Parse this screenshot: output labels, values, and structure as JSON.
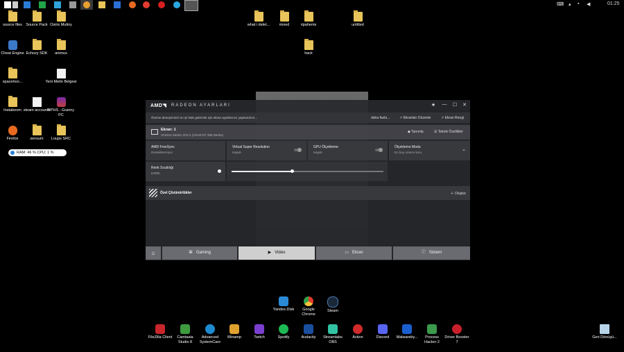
{
  "taskbar": {
    "tray_clock": "01:25"
  },
  "desktop": {
    "icons": [
      {
        "label": "source files"
      },
      {
        "label": "Source Pack"
      },
      {
        "label": "Osiris Mutiny"
      },
      {
        "label": "what i delet..."
      },
      {
        "label": "mixed"
      },
      {
        "label": "ripahems"
      },
      {
        "label": "untitled"
      },
      {
        "label": "Cheat Engine"
      },
      {
        "label": "Echozy SDK"
      },
      {
        "label": "animus"
      },
      {
        "label": "hack"
      },
      {
        "label": "spacehoo..."
      },
      {
        "label": "Yeni Metin Belgesi"
      },
      {
        "label": "Instaboom"
      },
      {
        "label": "steam accounts"
      },
      {
        "label": "RPHS - Granny PC"
      },
      {
        "label": "Firefox"
      },
      {
        "label": "sensum"
      },
      {
        "label": "Loups SRC"
      }
    ]
  },
  "widget": {
    "text": "RAM: 46 %  CPU: 1 %"
  },
  "amd": {
    "logo": "AMD◥",
    "title": "RADEON AYARLARI",
    "info_text": "Özeme deneyiminizi en iyi hale getirmek için ekran ayarlarınızı yapılandırın...",
    "more_link": "daha fazla...",
    "link_screen_layout": "Ekranları Düzenle",
    "link_screen_color": "Ekran Rengi",
    "display": {
      "name": "Ekran: 1",
      "sub": "VA2214 Series, DVI-1 (ASUS R7 265 Series)",
      "btn_identify": "Tanımla",
      "btn_specs": "Teknik Özellikler"
    },
    "settings": [
      {
        "label": "AMD FreeSync",
        "value": "Desteklenmiyor"
      },
      {
        "label": "Virtual Super Resolution",
        "value": "Kapalı"
      },
      {
        "label": "GPU Ölçekleme",
        "value": "Kapalı"
      },
      {
        "label": "Ölçekleme Modu",
        "value": "En boy oranını koru"
      },
      {
        "label": "Renk Sıcaklığı",
        "value": "6400K"
      }
    ],
    "color_temp_fraction": 0.4,
    "custom_resolutions": "Özel Çözünürlükler",
    "add_button": "Oluştur",
    "tabs": [
      {
        "label": "Gaming"
      },
      {
        "label": "Video"
      },
      {
        "label": "Ekran"
      },
      {
        "label": "Sistem"
      }
    ]
  },
  "dock": {
    "top_row": [
      {
        "label": "Yandex.Disk"
      },
      {
        "label": "Google Chrome"
      },
      {
        "label": "Steam"
      }
    ],
    "bottom_row": [
      {
        "label": "FileZilla Client"
      },
      {
        "label": "Camtasia Studio 8"
      },
      {
        "label": "Advanced SystemCare"
      },
      {
        "label": "Winamp"
      },
      {
        "label": "Twitch"
      },
      {
        "label": "Spotify"
      },
      {
        "label": "Audacity"
      },
      {
        "label": "Streamlabs OBS"
      },
      {
        "label": "Action"
      },
      {
        "label": "Discord"
      },
      {
        "label": "Malwareby..."
      },
      {
        "label": "Process Hacker 2"
      },
      {
        "label": "Driver Booster 7"
      }
    ],
    "recycle": "Geri Dönüşü..."
  }
}
